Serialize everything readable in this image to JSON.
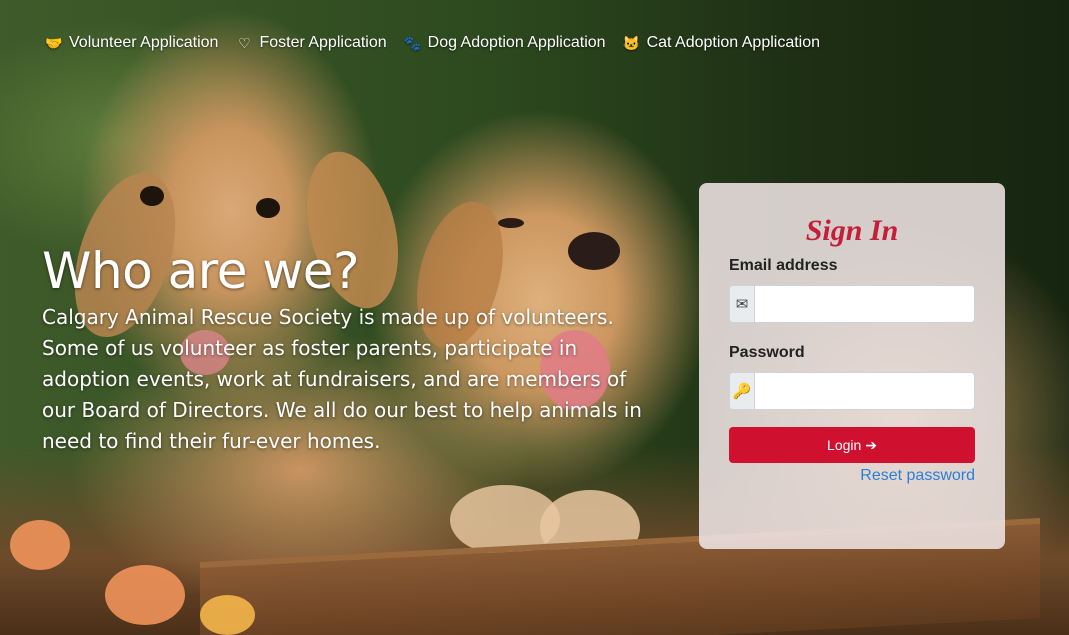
{
  "nav": {
    "items": [
      {
        "label": "Volunteer Application",
        "icon": "handshake-icon"
      },
      {
        "label": "Foster Application",
        "icon": "heart-icon"
      },
      {
        "label": "Dog Adoption Application",
        "icon": "paw-icon"
      },
      {
        "label": "Cat Adoption Application",
        "icon": "cat-icon"
      }
    ]
  },
  "hero": {
    "title": "Who are we?",
    "body": "Calgary Animal Rescue Society is made up of volunteers. Some of us volunteer as foster parents, participate in adoption events, work at fundraisers, and are members of our Board of Directors. We all do our best to help animals in need to find their fur-ever homes."
  },
  "signin": {
    "title": "Sign In",
    "email_label": "Email address",
    "email_value": "",
    "email_icon": "envelope-icon",
    "password_label": "Password",
    "password_value": "",
    "password_icon": "key-icon",
    "login_label": "Login",
    "login_icon": "sign-in-icon",
    "reset_label": "Reset password"
  },
  "colors": {
    "accent": "#d0102f",
    "title_red": "#c41e3a",
    "link_blue": "#2b7fd6"
  }
}
